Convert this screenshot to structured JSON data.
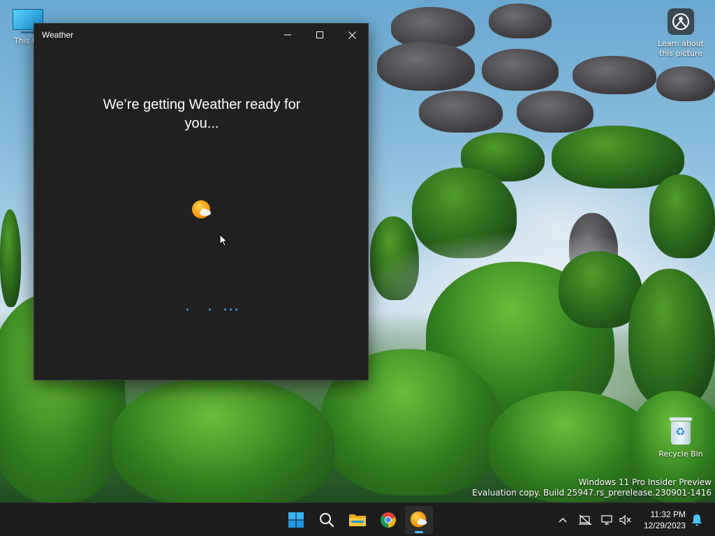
{
  "desktop": {
    "icons": {
      "this_pc": "This PC",
      "learn_line1": "Learn about",
      "learn_line2": "this picture",
      "recycle_bin": "Recycle Bin"
    },
    "watermark": {
      "line1": "Windows 11 Pro Insider Preview",
      "line2": "Evaluation copy. Build 25947.rs_prerelease.230901-1416"
    }
  },
  "window": {
    "title": "Weather",
    "loading_line1": "We’re getting Weather ready for",
    "loading_line2": "you...",
    "logo_icon": "weather-sun-cloud-icon",
    "progress": "indeterminate"
  },
  "taskbar": {
    "apps": [
      "start-icon",
      "search-icon",
      "file-explorer-icon",
      "chrome-icon",
      "weather-icon"
    ],
    "active_app": "Weather",
    "tray_icons": [
      "chevron-up-icon",
      "network-icon",
      "display-icon",
      "volume-muted-icon",
      "notification-bell-icon"
    ],
    "time": "11:32 PM",
    "date": "12/29/2023"
  },
  "colors": {
    "window_bg": "#202020",
    "taskbar_bg": "#1c1c1c",
    "accent": "#4cc2ff",
    "progress_dots": "#3a9ad9"
  }
}
